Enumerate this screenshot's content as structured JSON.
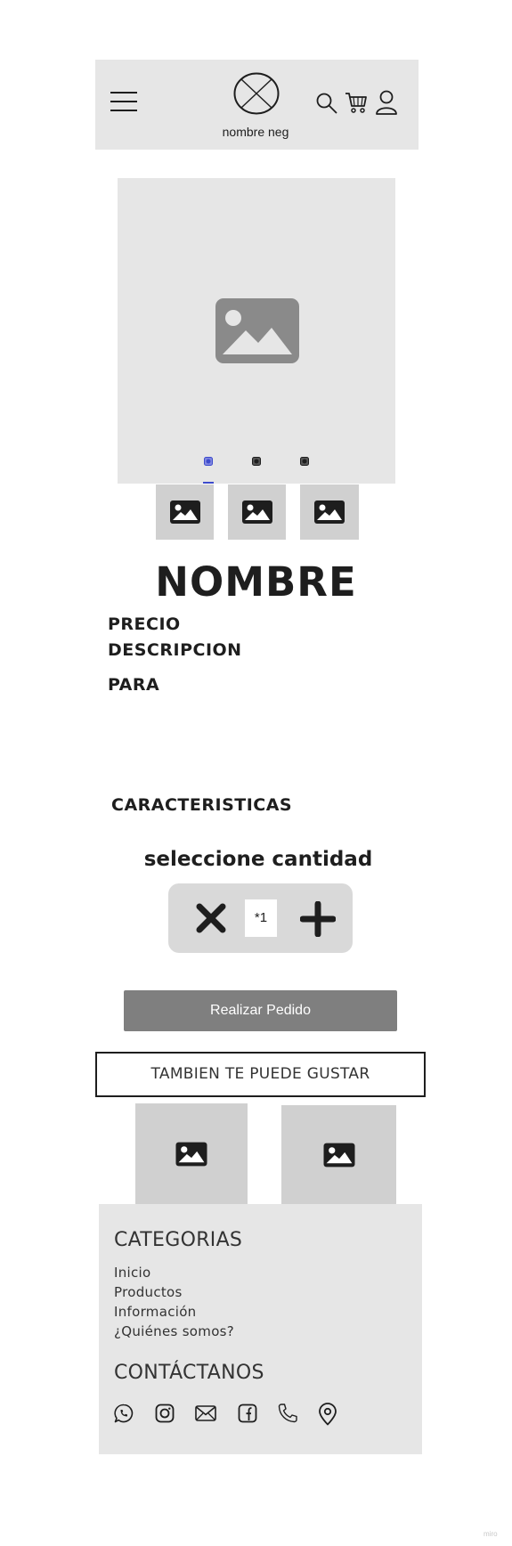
{
  "header": {
    "brand_name": "nombre neg",
    "icons": [
      "menu-icon",
      "logo-placeholder",
      "search-icon",
      "cart-icon",
      "user-icon"
    ]
  },
  "carousel": {
    "slide_count": 3,
    "active_index": 0,
    "thumbnail_count": 3
  },
  "product": {
    "name": "NOMBRE",
    "price_label": "PRECIO",
    "description_label": "DESCRIPCION",
    "for_label": "PARA",
    "features_label": "CARACTERISTICAS"
  },
  "quantity": {
    "title": "seleccione cantidad",
    "value": "*1",
    "decrease_icon": "x-icon",
    "increase_icon": "plus-icon"
  },
  "order_button": "Realizar Pedido",
  "recommendations": {
    "title": "TAMBIEN TE PUEDE GUSTAR",
    "item_count": 2
  },
  "footer": {
    "categories_title": "CATEGORIAS",
    "links": [
      "Inicio",
      "Productos",
      "Información",
      "¿Quiénes somos?"
    ],
    "contact_title": "CONTÁCTANOS",
    "social_icons": [
      "whatsapp-icon",
      "instagram-icon",
      "mail-icon",
      "facebook-icon",
      "phone-icon",
      "location-icon"
    ]
  },
  "watermark": "miro",
  "colors": {
    "panel": "#e6e6e6",
    "placeholder": "#d0d0d0",
    "button": "#7f7f7f",
    "active_dot": "#3d4bcc"
  }
}
